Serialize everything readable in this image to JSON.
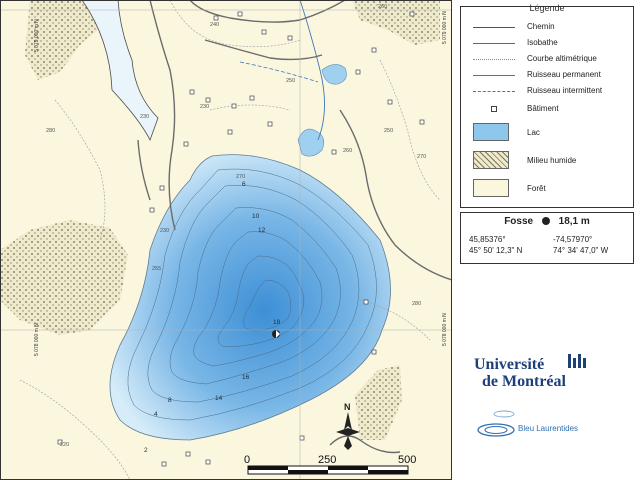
{
  "map": {
    "contour_labels": [
      "240",
      "250",
      "230",
      "260",
      "250",
      "280",
      "270",
      "260",
      "230",
      "230",
      "220",
      "255",
      "280",
      "270"
    ],
    "depth_labels": [
      "6",
      "10",
      "12",
      "18",
      "16",
      "14",
      "8",
      "4",
      "2"
    ],
    "grid_labels": [
      "5 078 000 m N",
      "5 079 000 m N",
      "5 078 000 m N",
      "5 079 000 m N"
    ],
    "scale": {
      "labels": [
        "0",
        "250",
        "500"
      ]
    },
    "north_label": "N",
    "colors": {
      "forest": "#fbf6de",
      "lake_edge": "#d4eaf8",
      "lake_center": "#3d8fd6",
      "wetland": "#e8e3c8",
      "road": "#6b6b6b"
    }
  },
  "legend": {
    "title": "Légende",
    "items": [
      {
        "label": "Chemin",
        "icon": "road-line-icon"
      },
      {
        "label": "Isobathe",
        "icon": "isobath-line-icon"
      },
      {
        "label": "Courbe altimétrique",
        "icon": "contour-line-icon"
      },
      {
        "label": "Ruisseau permanent",
        "icon": "stream-permanent-icon"
      },
      {
        "label": "Ruisseau intermittent",
        "icon": "stream-intermittent-icon"
      },
      {
        "label": "Bâtiment",
        "icon": "building-icon"
      },
      {
        "label": "Lac",
        "icon": "lake-swatch-icon"
      },
      {
        "label": "Milieu humide",
        "icon": "wetland-swatch-icon"
      },
      {
        "label": "Forêt",
        "icon": "forest-swatch-icon"
      }
    ]
  },
  "fosse": {
    "label": "Fosse",
    "icon": "deepest-point-icon",
    "depth": "18,1 m",
    "lat_dec": "45,85376°",
    "lon_dec": "-74,57970°",
    "lat_dms": "45° 50' 12,3\" N",
    "lon_dms": "74° 34' 47,0\" W"
  },
  "logos": {
    "udem_line1": "Université",
    "udem_line2": "de Montréal",
    "bleu": "Bleu Laurentides"
  }
}
